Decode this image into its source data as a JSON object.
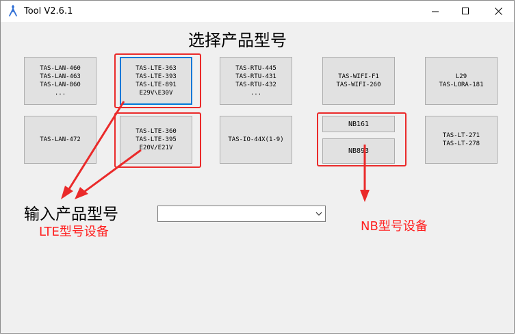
{
  "window": {
    "title": "Tool V2.6.1"
  },
  "heading": "选择产品型号",
  "products_row1": [
    {
      "label": "TAS-LAN-460\nTAS-LAN-463\nTAS-LAN-860\n..."
    },
    {
      "label": "TAS-LTE-363\nTAS-LTE-393\nTAS-LTE-891\nE29V\\E30V"
    },
    {
      "label": "TAS-RTU-445\nTAS-RTU-431\nTAS-RTU-432\n..."
    },
    {
      "label": "TAS-WIFI-F1\nTAS-WIFI-260"
    },
    {
      "label": "L29\nTAS-LORA-181"
    }
  ],
  "products_row2": [
    {
      "label": "TAS-LAN-472"
    },
    {
      "label": "TAS-LTE-360\nTAS-LTE-395\nE20V/E21V"
    },
    {
      "label": "TAS-IO-44X(1-9)"
    },
    {
      "label": "NB161"
    },
    {
      "label": "NB893"
    },
    {
      "label": "TAS-LT-271\nTAS-LT-278"
    }
  ],
  "input": {
    "label": "输入产品型号",
    "value": ""
  },
  "annotations": {
    "lte": "LTE型号设备",
    "nb": "NB型号设备",
    "color": "#ff2020"
  },
  "colors": {
    "focus": "#0078d7",
    "button_bg": "#e1e1e1",
    "window_bg": "#f0f0f0"
  }
}
